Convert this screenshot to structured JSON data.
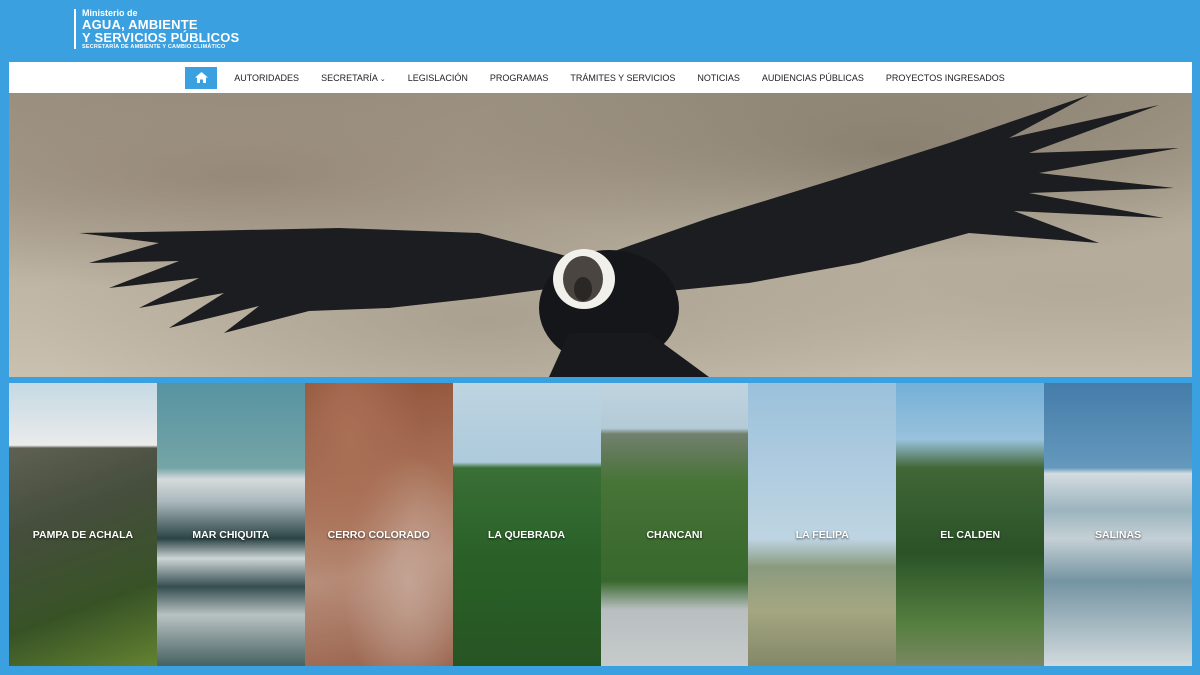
{
  "header": {
    "logo_line1": "Ministerio de",
    "logo_line2": "AGUA, AMBIENTE",
    "logo_line3": "Y SERVICIOS PÚBLICOS",
    "logo_line4": "SECRETARÍA DE AMBIENTE Y CAMBIO CLIMÁTICO"
  },
  "nav": {
    "home_icon": "home-icon",
    "items": [
      {
        "label": "AUTORIDADES"
      },
      {
        "label": "SECRETARÍA",
        "dropdown": true
      },
      {
        "label": "LEGISLACIÓN"
      },
      {
        "label": "PROGRAMAS"
      },
      {
        "label": "TRÁMITES Y SERVICIOS"
      },
      {
        "label": "NOTICIAS"
      },
      {
        "label": "AUDIENCIAS PÚBLICAS"
      },
      {
        "label": "PROYECTOS INGRESADOS"
      }
    ]
  },
  "tiles": [
    {
      "label": "PAMPA DE ACHALA"
    },
    {
      "label": "MAR CHIQUITA"
    },
    {
      "label": "CERRO COLORADO"
    },
    {
      "label": "LA QUEBRADA"
    },
    {
      "label": "CHANCANI"
    },
    {
      "label": "LA FELIPA"
    },
    {
      "label": "EL CALDEN"
    },
    {
      "label": "SALINAS"
    }
  ],
  "colors": {
    "brand_blue": "#3aa0e0",
    "nav_bg": "#ffffff"
  }
}
